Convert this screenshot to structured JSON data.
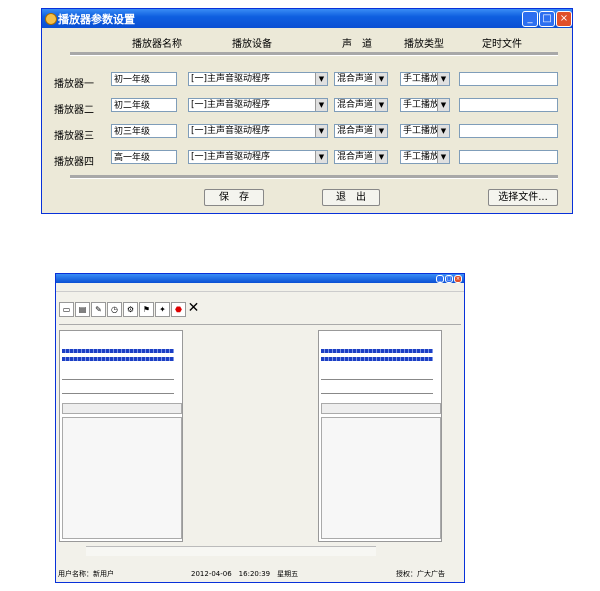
{
  "dialog": {
    "title": "播放器参数设置",
    "headers": [
      "播放器名称",
      "播放设备",
      "声　道",
      "播放类型",
      "定时文件"
    ],
    "rows": [
      {
        "label": "播放器一",
        "name": "初一年级",
        "device": "[一]主声音驱动程序",
        "channel": "混合声道",
        "type": "手工播放",
        "file": ""
      },
      {
        "label": "播放器二",
        "name": "初二年级",
        "device": "[一]主声音驱动程序",
        "channel": "混合声道",
        "type": "手工播放",
        "file": ""
      },
      {
        "label": "播放器三",
        "name": "初三年级",
        "device": "[一]主声音驱动程序",
        "channel": "混合声道",
        "type": "手工播放",
        "file": ""
      },
      {
        "label": "播放器四",
        "name": "高一年级",
        "device": "[一]主声音驱动程序",
        "channel": "混合声道",
        "type": "手工播放",
        "file": ""
      }
    ],
    "save_label": "保　存",
    "exit_label": "退　出",
    "choose_file_label": "选择文件..."
  },
  "app": {
    "status": {
      "user": "用户名称：新用户",
      "datetime": "2012-04-06　16:20:39　星期五",
      "copyright": "授权：广大广告"
    }
  }
}
